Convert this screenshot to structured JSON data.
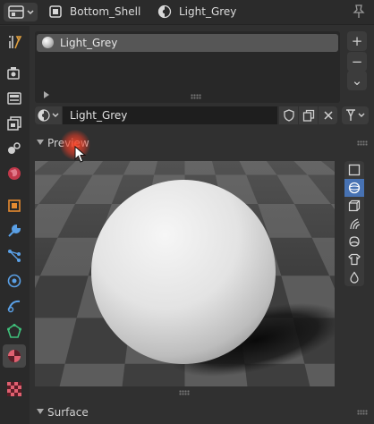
{
  "header": {
    "object_name": "Bottom_Shell",
    "material_name": "Light_Grey",
    "icons": [
      "editor-type-icon",
      "mesh-object-icon",
      "material-icon",
      "pin-icon"
    ]
  },
  "tabs": [
    {
      "name": "tool",
      "icon": "tool-icon"
    },
    {
      "name": "render",
      "icon": "render-icon"
    },
    {
      "name": "output",
      "icon": "output-icon"
    },
    {
      "name": "view-layer",
      "icon": "view-layer-icon"
    },
    {
      "name": "scene",
      "icon": "scene-icon"
    },
    {
      "name": "world",
      "icon": "world-icon"
    },
    {
      "name": "object",
      "icon": "object-icon"
    },
    {
      "name": "modifiers",
      "icon": "wrench-icon"
    },
    {
      "name": "particles",
      "icon": "particles-icon"
    },
    {
      "name": "physics",
      "icon": "physics-icon"
    },
    {
      "name": "constraints",
      "icon": "constraints-icon"
    },
    {
      "name": "data",
      "icon": "mesh-data-icon"
    },
    {
      "name": "material",
      "icon": "material-icon",
      "active": true
    },
    {
      "name": "texture",
      "icon": "checker-icon"
    }
  ],
  "material_slots": {
    "items": [
      {
        "label": "Light_Grey",
        "selected": true
      }
    ],
    "side_buttons": [
      "+",
      "−",
      "⌄"
    ]
  },
  "material_selector": {
    "value": "Light_Grey"
  },
  "panels": {
    "preview": {
      "title": "Preview",
      "expanded": true
    },
    "surface": {
      "title": "Surface",
      "expanded": true
    }
  },
  "preview_types": [
    {
      "name": "flat",
      "icon": "square-icon"
    },
    {
      "name": "sphere",
      "icon": "sphere-icon",
      "selected": true
    },
    {
      "name": "cube",
      "icon": "cube-icon"
    },
    {
      "name": "hair",
      "icon": "hair-icon"
    },
    {
      "name": "monkey",
      "icon": "monkey-icon"
    },
    {
      "name": "cloth",
      "icon": "cloth-icon"
    },
    {
      "name": "fluid",
      "icon": "droplet-icon"
    }
  ],
  "colors": {
    "accent": "#4772b3",
    "panel": "#303030",
    "header": "#2b2b2b",
    "cursor_highlight": "#e04a30"
  }
}
